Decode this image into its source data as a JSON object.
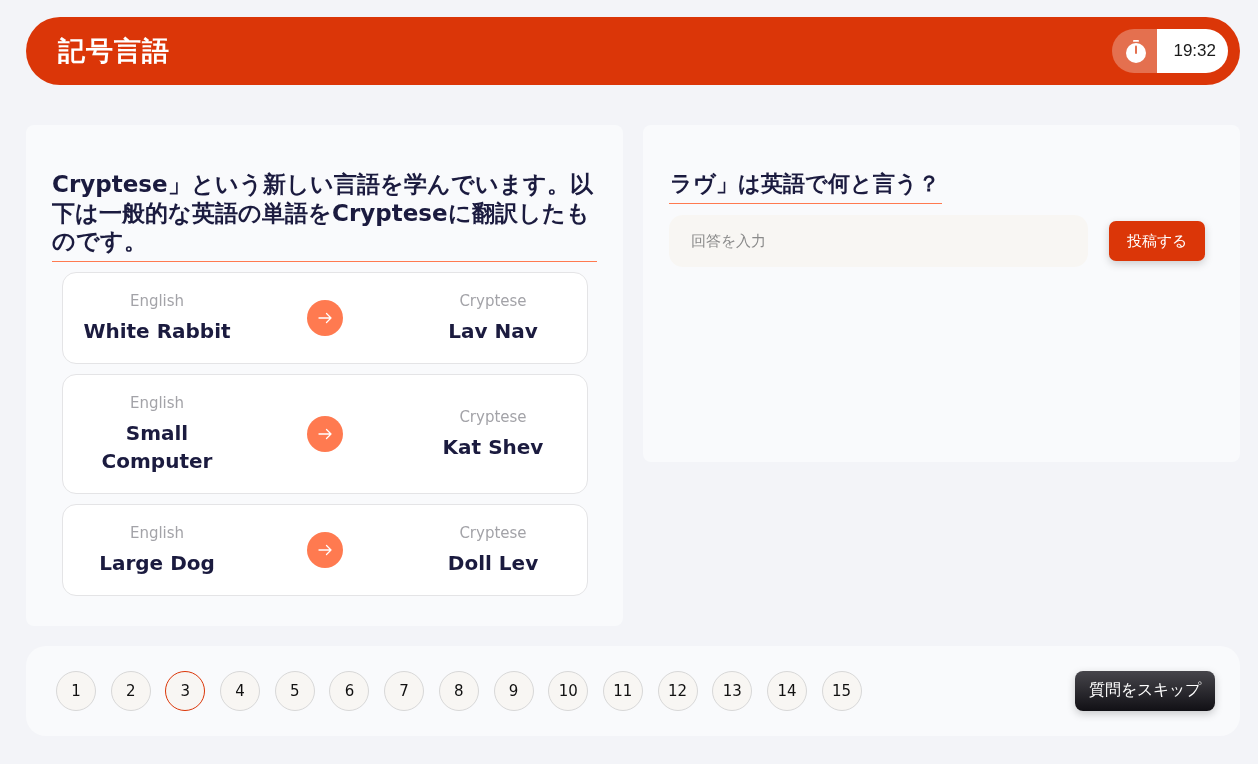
{
  "header": {
    "title": "記号言語",
    "timer": "19:32"
  },
  "examples": {
    "intro": "Cryptese」という新しい言語を学んでいます。以下は一般的な英語の単語をCrypteseに翻訳したものです。",
    "pairs": [
      {
        "source_label": "English",
        "source": "White Rabbit",
        "target_label": "Cryptese",
        "target": "Lav Nav"
      },
      {
        "source_label": "English",
        "source": "Small Computer",
        "target_label": "Cryptese",
        "target": "Kat Shev"
      },
      {
        "source_label": "English",
        "source": "Large Dog",
        "target_label": "Cryptese",
        "target": "Doll Lev"
      }
    ]
  },
  "question": {
    "prompt": "ラヴ」は英語で何と言う？",
    "answer": {
      "placeholder": "回答を入力"
    },
    "submit": "投稿する"
  },
  "pagination": {
    "pages": [
      {
        "label": "1",
        "selected": false
      },
      {
        "label": "2",
        "selected": false
      },
      {
        "label": "3",
        "selected": true
      },
      {
        "label": "4",
        "selected": false
      },
      {
        "label": "5",
        "selected": false
      },
      {
        "label": "6",
        "selected": false
      },
      {
        "label": "7",
        "selected": false
      },
      {
        "label": "8",
        "selected": false
      },
      {
        "label": "9",
        "selected": false
      },
      {
        "label": "10",
        "selected": false
      },
      {
        "label": "11",
        "selected": false
      },
      {
        "label": "12",
        "selected": false
      },
      {
        "label": "13",
        "selected": false
      },
      {
        "label": "14",
        "selected": false
      },
      {
        "label": "15",
        "selected": false
      }
    ],
    "skip": "質問をスキップ"
  }
}
